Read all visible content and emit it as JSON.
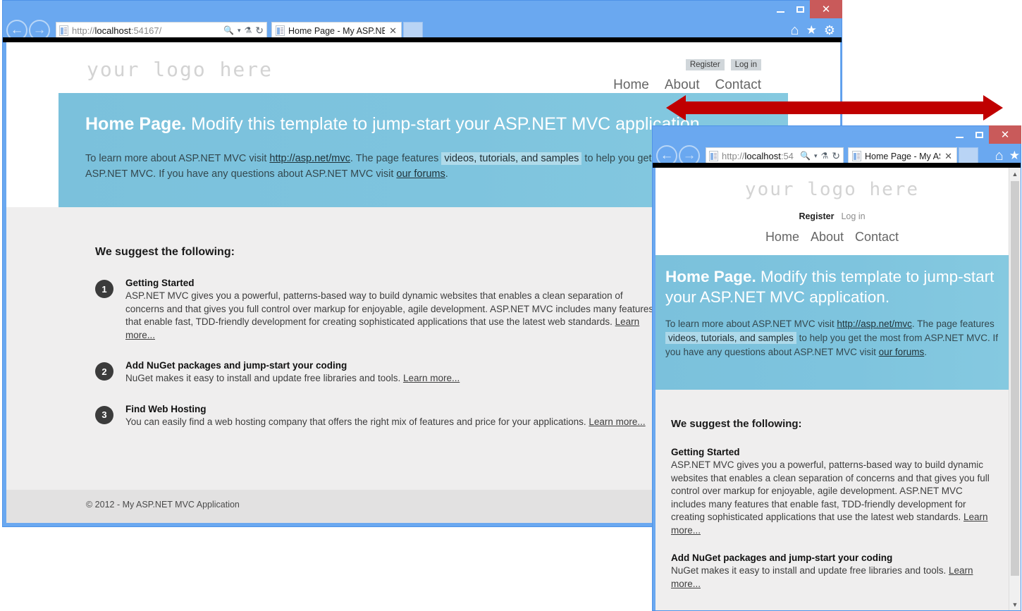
{
  "annotation": {
    "name": "responsive-resize-arrow",
    "color": "#c00000"
  },
  "main_window": {
    "title_bar": {
      "minimize": "–",
      "maximize": "❐",
      "close": "✕"
    },
    "nav": {
      "back": "←",
      "forward": "→"
    },
    "address": {
      "scheme": "http://",
      "host": "localhost",
      "port_path": ":54167/",
      "full": "http://localhost:54167/",
      "search_icon": "🔍",
      "dropdown_icon": "▾",
      "compat_icon": "⚗",
      "refresh_icon": "↻"
    },
    "tab": {
      "label": "Home Page - My ASP.NET ...",
      "close": "✕"
    },
    "chrome_icons": {
      "home": "⌂",
      "favorites": "★",
      "tools": "⚙"
    },
    "page": {
      "logo": "your logo here",
      "auth": [
        {
          "label": "Register",
          "boxed": true
        },
        {
          "label": "Log in",
          "boxed": true
        }
      ],
      "nav": [
        "Home",
        "About",
        "Contact"
      ],
      "hero": {
        "title_bold": "Home Page.",
        "title_rest": " Modify this template to jump-start your ASP.NET MVC application.",
        "body_1": "To learn more about ASP.NET MVC visit ",
        "link_1": "http://asp.net/mvc",
        "body_2": ". The page features ",
        "highlight": "videos, tutorials, and samples",
        "body_3": " to help you get the most from ASP.NET MVC. If you have any questions about ASP.NET MVC visit ",
        "link_2": "our forums",
        "body_4": "."
      },
      "suggest_heading": "We suggest the following:",
      "items": [
        {
          "number": "1",
          "title": "Getting Started",
          "body": "ASP.NET MVC gives you a powerful, patterns-based way to build dynamic websites that enables a clean separation of concerns and that gives you full control over markup for enjoyable, agile development. ASP.NET MVC includes many features that enable fast, TDD-friendly development for creating sophisticated applications that use the latest web standards. ",
          "link": "Learn more..."
        },
        {
          "number": "2",
          "title": "Add NuGet packages and jump-start your coding",
          "body": "NuGet makes it easy to install and update free libraries and tools. ",
          "link": "Learn more..."
        },
        {
          "number": "3",
          "title": "Find Web Hosting",
          "body": "You can easily find a web hosting company that offers the right mix of features and price for your applications. ",
          "link": "Learn more..."
        }
      ],
      "footer": "© 2012 - My ASP.NET MVC Application"
    }
  },
  "small_window": {
    "title_bar": {
      "minimize": "–",
      "maximize": "❐",
      "close": "✕"
    },
    "nav": {
      "back": "←",
      "forward": "→"
    },
    "address": {
      "scheme": "http://",
      "host": "localhost",
      "port_path": ":54",
      "full": "http://localhost:54",
      "search_icon": "🔍",
      "dropdown_icon": "▾",
      "compat_icon": "⚗",
      "refresh_icon": "↻"
    },
    "tab": {
      "label": "Home Page - My ASP....",
      "close": "✕"
    },
    "chrome_icons": {
      "home": "⌂",
      "favorites": "★"
    },
    "scrollbar": {
      "up": "▲",
      "down": "▼"
    },
    "page": {
      "logo": "your logo here",
      "auth": [
        {
          "label": "Register",
          "boxed": false
        },
        {
          "label": "Log in",
          "boxed": false
        }
      ],
      "nav": [
        "Home",
        "About",
        "Contact"
      ],
      "hero": {
        "title_bold": "Home Page.",
        "title_rest": " Modify this template to jump-start your ASP.NET MVC application.",
        "body_1": "To learn more about ASP.NET MVC visit ",
        "link_1": "http://asp.net/mvc",
        "body_2": ". The page features ",
        "highlight": "videos, tutorials, and samples",
        "body_3": " to help you get the most from ASP.NET MVC. If you have any questions about ASP.NET MVC visit ",
        "link_2": "our forums",
        "body_4": "."
      },
      "suggest_heading": "We suggest the following:",
      "items": [
        {
          "title": "Getting Started",
          "body": "ASP.NET MVC gives you a powerful, patterns-based way to build dynamic websites that enables a clean separation of concerns and that gives you full control over markup for enjoyable, agile development. ASP.NET MVC includes many features that enable fast, TDD-friendly development for creating sophisticated applications that use the latest web standards. ",
          "link": "Learn more..."
        },
        {
          "title": "Add NuGet packages and jump-start your coding",
          "body": "NuGet makes it easy to install and update free libraries and tools. ",
          "link": "Learn more..."
        }
      ]
    }
  }
}
